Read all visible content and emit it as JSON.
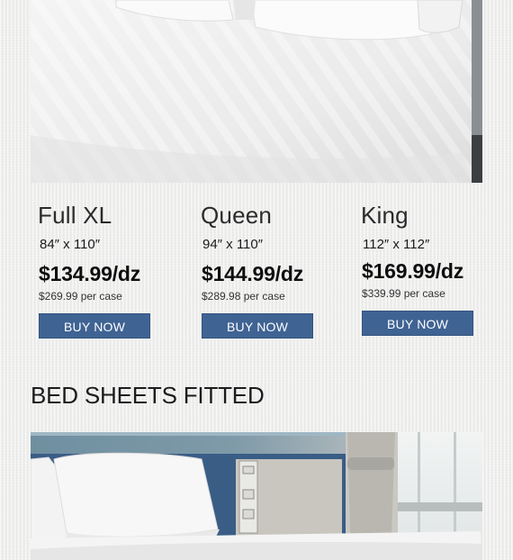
{
  "products": [
    {
      "name": "Full XL",
      "size": "84″ x 110″",
      "price": "$134.99/dz",
      "case_price": "$269.99 per case",
      "button": "BUY NOW"
    },
    {
      "name": "Queen",
      "size": "94″ x 110″",
      "price": "$144.99/dz",
      "case_price": "$289.98 per case",
      "button": "BUY NOW"
    },
    {
      "name": "King",
      "size": "112″ x 112″",
      "price": "$169.99/dz",
      "case_price": "$339.99 per case",
      "button": "BUY NOW"
    }
  ],
  "section": {
    "title": "BED SHEETS FITTED"
  },
  "images": [
    {
      "name": "white-bed-sheets-photo"
    },
    {
      "name": "hotel-bed-photo"
    }
  ],
  "colors": {
    "button": "#3f6393",
    "background": "#efefee",
    "headboard": "#3a5d86"
  }
}
